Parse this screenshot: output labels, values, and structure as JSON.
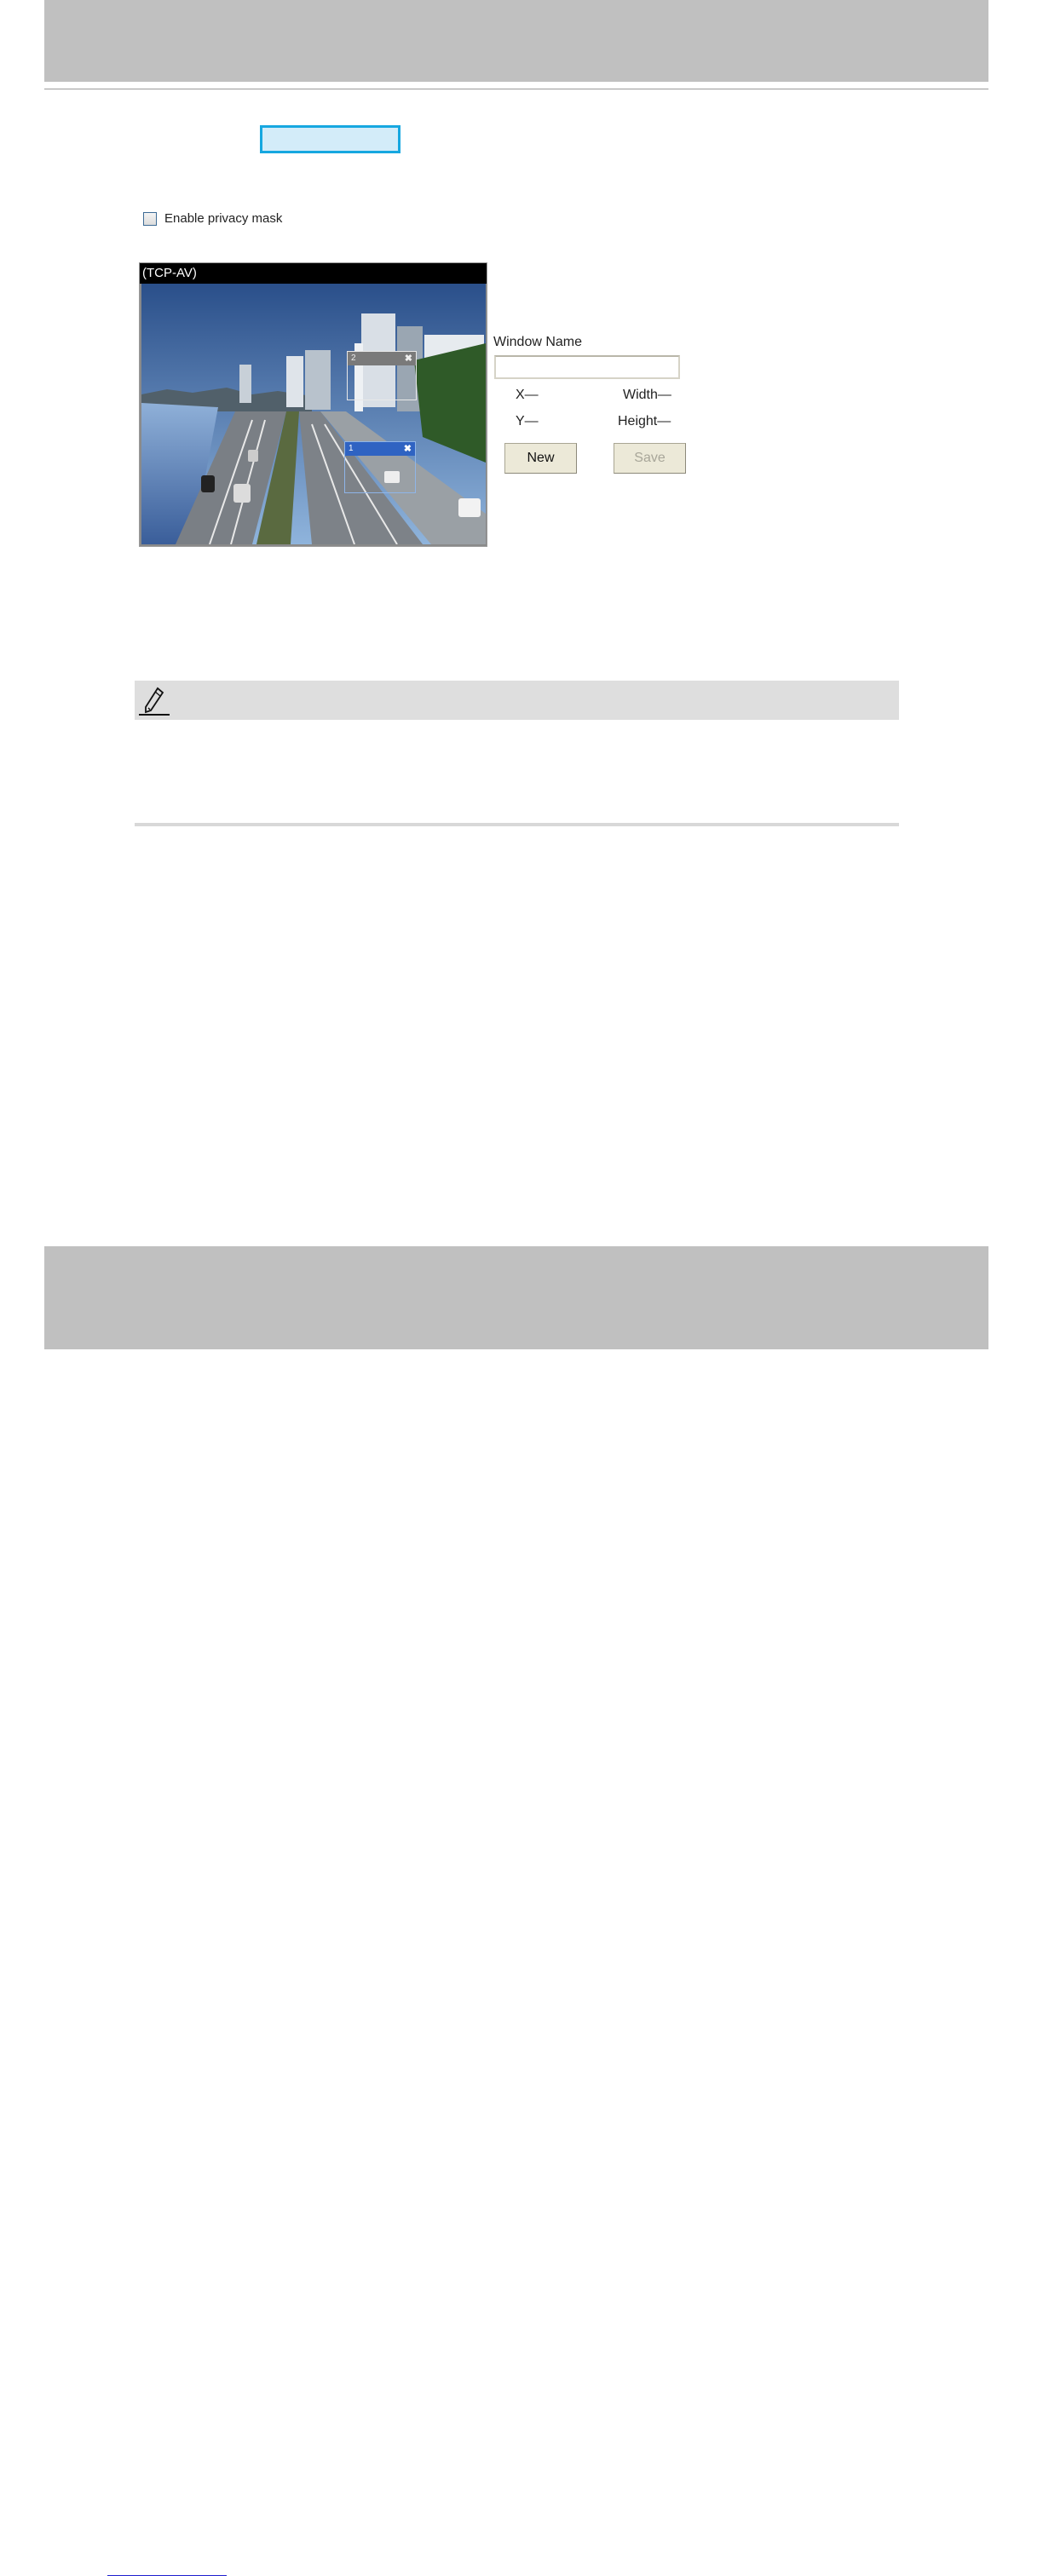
{
  "privacy": {
    "enable_label": "Enable privacy mask",
    "enabled": false
  },
  "video": {
    "title": "(TCP-AV)",
    "masks": [
      {
        "id": "2",
        "close_icon": "close-icon",
        "style": "inactive"
      },
      {
        "id": "1",
        "close_icon": "close-icon",
        "style": "active"
      }
    ]
  },
  "form": {
    "window_name_label": "Window Name",
    "window_name_value": "",
    "x_label": "X—",
    "y_label": "Y—",
    "width_label": "Width—",
    "height_label": "Height—",
    "new_label": "New",
    "save_label": "Save"
  },
  "note": {
    "icon": "pencil-icon"
  },
  "colors": {
    "highlight_border": "#16a7e0",
    "active_mask": "#2f63c2",
    "bar_gray": "#c0c0c0"
  }
}
